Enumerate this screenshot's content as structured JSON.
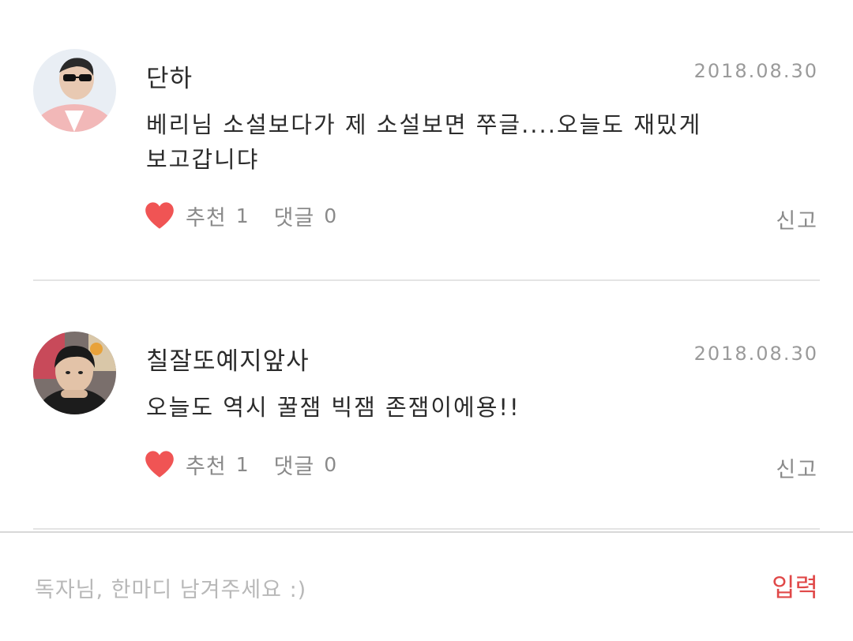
{
  "comments": [
    {
      "author": "단하",
      "date": "2018.08.30",
      "text_lines": [
        "베리님 소설보다가 제 소설보면 쭈글....오늘도 재밌게",
        "보고갑니댜"
      ],
      "like_label": "추천",
      "like_count": "1",
      "reply_label": "댓글",
      "reply_count": "0",
      "report_label": "신고"
    },
    {
      "author": "칠잘또예지앞사",
      "date": "2018.08.30",
      "text_lines": [
        "오늘도 역시 꿀잼 빅잼 존잼이에용!!"
      ],
      "like_label": "추천",
      "like_count": "1",
      "reply_label": "댓글",
      "reply_count": "0",
      "report_label": "신고"
    }
  ],
  "input": {
    "placeholder": "독자님, 한마디 남겨주세요 :)",
    "value": "",
    "submit_label": "입력"
  },
  "colors": {
    "heart": "#f05454",
    "submit": "#e04848",
    "muted_text": "#8a8a8a",
    "date_text": "#9a9a9a",
    "divider": "#e4e4e4"
  },
  "icons": [
    "heart-icon"
  ]
}
